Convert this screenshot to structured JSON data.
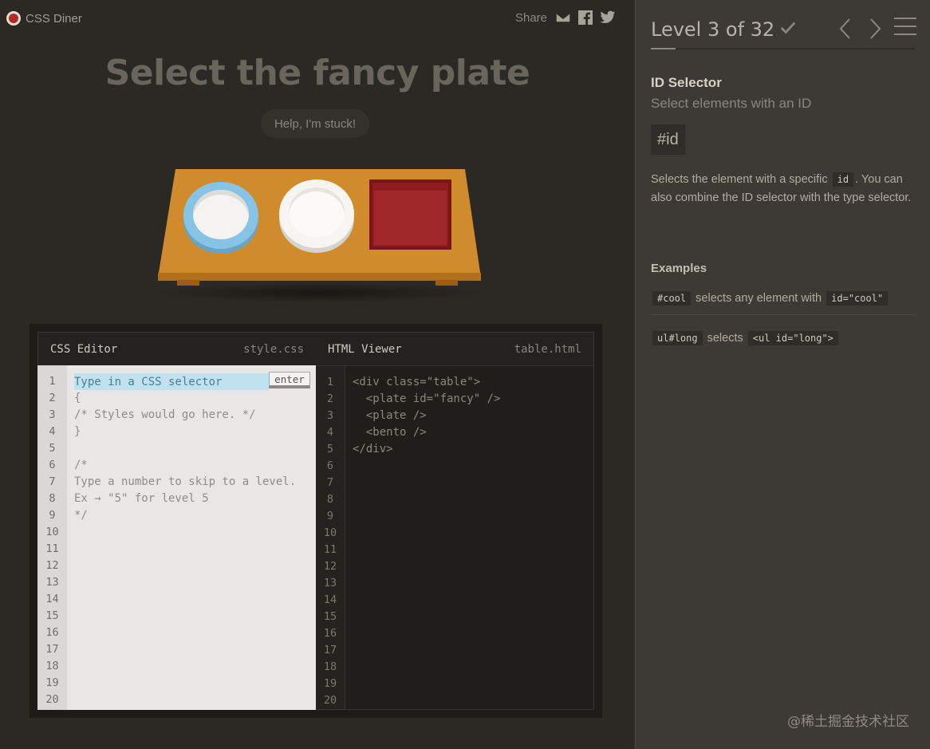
{
  "header": {
    "logo_text": "CSS Diner",
    "share_label": "Share",
    "share_icons": [
      "email-icon",
      "facebook-icon",
      "twitter-icon"
    ]
  },
  "game": {
    "order": "Select the fancy plate",
    "help_button": "Help, I'm stuck!",
    "table_items": [
      "plate#fancy",
      "plate",
      "bento"
    ]
  },
  "css_editor": {
    "title": "CSS Editor",
    "filename": "style.css",
    "input_placeholder": "Type in a CSS selector",
    "enter_label": "enter",
    "lines": [
      "{",
      "/* Styles would go here. */",
      "}",
      "",
      "/*",
      "Type a number to skip to a level.",
      "Ex → \"5\" for level 5",
      "*/"
    ],
    "line_numbers": [
      "1",
      "2",
      "3",
      "4",
      "5",
      "6",
      "7",
      "8",
      "9",
      "10",
      "11",
      "12",
      "13",
      "14",
      "15",
      "16",
      "17",
      "18",
      "19",
      "20"
    ]
  },
  "html_viewer": {
    "title": "HTML Viewer",
    "filename": "table.html",
    "lines": [
      "<div class=\"table\">",
      "  <plate id=\"fancy\" />",
      "  <plate />",
      "  <bento />",
      "</div>"
    ],
    "line_numbers": [
      "1",
      "2",
      "3",
      "4",
      "5",
      "6",
      "7",
      "8",
      "9",
      "10",
      "11",
      "12",
      "13",
      "14",
      "15",
      "16",
      "17",
      "18",
      "19",
      "20"
    ]
  },
  "sidebar": {
    "level_title": "Level 3 of 32",
    "level_current": 3,
    "level_total": 32,
    "selector_name": "ID Selector",
    "selector_title": "Select elements with an ID",
    "syntax": "#id",
    "description": {
      "before": "Selects the element with a specific ",
      "code": "id",
      "after": ". You can also combine the ID selector with the type selector."
    },
    "examples_title": "Examples",
    "examples": [
      {
        "code": "#cool",
        "text": " selects any element with ",
        "code2": "id=\"cool\""
      },
      {
        "code": "ul#long",
        "text": " selects ",
        "code2": "<ul id=\"long\">"
      }
    ]
  },
  "watermark": "@稀土掘金技术社区"
}
